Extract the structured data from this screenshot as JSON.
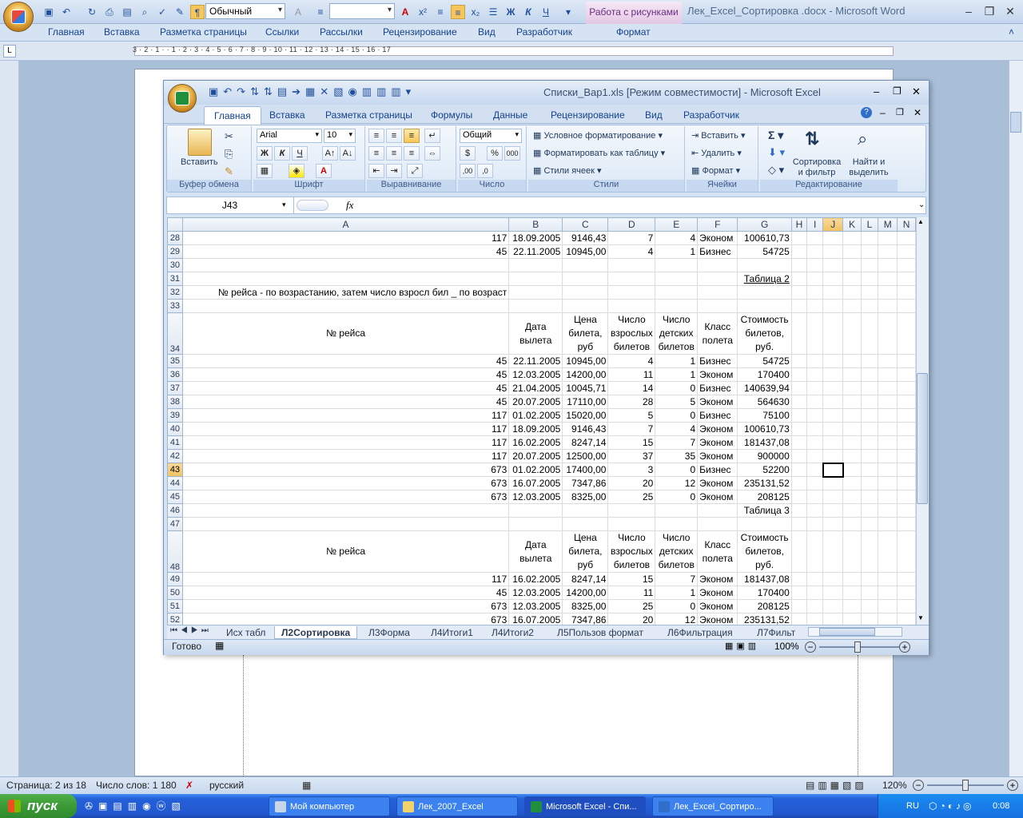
{
  "word": {
    "style_combo": "Обычный",
    "context_tab": "Работа с рисунками",
    "caption": "Лек_Excel_Сортировка .docx - Microsoft Word",
    "tabs": [
      "Главная",
      "Вставка",
      "Разметка страницы",
      "Ссылки",
      "Рассылки",
      "Рецензирование",
      "Вид",
      "Разработчик",
      "Формат"
    ],
    "ruler_numbers": "3 · 2 · 1 · · 1 · 2 · 3 · 4 · 5 · 6 · 7 · 8 · 9 · 10 · 11 · 12 · 13 · 14 · 15 · 16 · 17",
    "status": {
      "page": "Страница: 2 из 18",
      "words": "Число слов: 1 180",
      "lang": "русский",
      "zoom": "120%"
    }
  },
  "taskbar": {
    "start": "пуск",
    "items": [
      "Мой компьютер",
      "Лек_2007_Excel",
      "Microsoft Excel - Спи...",
      "Лек_Excel_Сортиро..."
    ],
    "lang": "RU",
    "clock": "0:08"
  },
  "excel": {
    "caption": "Списки_Вар1.xls  [Режим совместимости] - Microsoft Excel",
    "tabs": [
      "Главная",
      "Вставка",
      "Разметка страницы",
      "Формулы",
      "Данные",
      "Рецензирование",
      "Вид",
      "Разработчик"
    ],
    "ribbon": {
      "paste": "Вставить",
      "font_name": "Arial",
      "font_size": "10",
      "number_format": "Общий",
      "cond_format": "Условное форматирование",
      "format_table": "Форматировать как таблицу",
      "cell_styles": "Стили ячеек",
      "insert": "Вставить",
      "delete": "Удалить",
      "format": "Формат",
      "sort": "Сортировка и фильтр",
      "find": "Найти и выделить",
      "groups": [
        "Буфер обмена",
        "Шрифт",
        "Выравнивание",
        "Число",
        "Стили",
        "Ячейки",
        "Редактирование"
      ]
    },
    "name_box": "J43",
    "fx": "fx",
    "columns": [
      "A",
      "B",
      "C",
      "D",
      "E",
      "F",
      "G",
      "H",
      "I",
      "J",
      "K",
      "L",
      "M",
      "N"
    ],
    "rows": [
      {
        "n": "28",
        "cells": [
          "117",
          "18.09.2005",
          "9146,43",
          "7",
          "4",
          "Эконом",
          "100610,73"
        ]
      },
      {
        "n": "29",
        "cells": [
          "45",
          "22.11.2005",
          "10945,00",
          "4",
          "1",
          "Бизнес",
          "54725"
        ]
      },
      {
        "n": "30",
        "cells": [
          "",
          "",
          "",
          "",
          "",
          "",
          ""
        ]
      },
      {
        "n": "31",
        "cells": [
          "",
          "",
          "",
          "",
          "",
          "",
          "Таблица 2"
        ]
      },
      {
        "n": "32",
        "cells": [
          "№ рейса - по возрастанию, затем число взросл бил _ по возраст",
          "",
          "",
          "",
          "",
          "",
          ""
        ]
      },
      {
        "n": "33",
        "cells": [
          "",
          "",
          "",
          "",
          "",
          "",
          ""
        ]
      },
      {
        "n": "34",
        "hdr": true,
        "cells": [
          "№ рейса",
          "Дата вылета",
          "Цена билета, руб",
          "Число взрослых билетов",
          "Число детских билетов",
          "Класс полета",
          "Стоимость билетов, руб."
        ]
      },
      {
        "n": "35",
        "cells": [
          "45",
          "22.11.2005",
          "10945,00",
          "4",
          "1",
          "Бизнес",
          "54725"
        ]
      },
      {
        "n": "36",
        "cells": [
          "45",
          "12.03.2005",
          "14200,00",
          "11",
          "1",
          "Эконом",
          "170400"
        ]
      },
      {
        "n": "37",
        "cells": [
          "45",
          "21.04.2005",
          "10045,71",
          "14",
          "0",
          "Бизнес",
          "140639,94"
        ]
      },
      {
        "n": "38",
        "cells": [
          "45",
          "20.07.2005",
          "17110,00",
          "28",
          "5",
          "Эконом",
          "564630"
        ]
      },
      {
        "n": "39",
        "cells": [
          "117",
          "01.02.2005",
          "15020,00",
          "5",
          "0",
          "Бизнес",
          "75100"
        ]
      },
      {
        "n": "40",
        "cells": [
          "117",
          "18.09.2005",
          "9146,43",
          "7",
          "4",
          "Эконом",
          "100610,73"
        ]
      },
      {
        "n": "41",
        "cells": [
          "117",
          "16.02.2005",
          "8247,14",
          "15",
          "7",
          "Эконом",
          "181437,08"
        ]
      },
      {
        "n": "42",
        "cells": [
          "117",
          "20.07.2005",
          "12500,00",
          "37",
          "35",
          "Эконом",
          "900000"
        ]
      },
      {
        "n": "43",
        "cells": [
          "673",
          "01.02.2005",
          "17400,00",
          "3",
          "0",
          "Бизнес",
          "52200"
        ]
      },
      {
        "n": "44",
        "cells": [
          "673",
          "16.07.2005",
          "7347,86",
          "20",
          "12",
          "Эконом",
          "235131,52"
        ]
      },
      {
        "n": "45",
        "cells": [
          "673",
          "12.03.2005",
          "8325,00",
          "25",
          "0",
          "Эконом",
          "208125"
        ]
      },
      {
        "n": "46",
        "cells": [
          "",
          "",
          "",
          "",
          "",
          "",
          "Таблица 3"
        ]
      },
      {
        "n": "47",
        "cells": [
          "",
          "",
          "",
          "",
          "",
          "",
          ""
        ]
      },
      {
        "n": "48",
        "hdr": true,
        "cells": [
          "№ рейса",
          "Дата вылета",
          "Цена билета, руб",
          "Число взрослых билетов",
          "Число детских билетов",
          "Класс полета",
          "Стоимость билетов, руб."
        ]
      },
      {
        "n": "49",
        "cells": [
          "117",
          "16.02.2005",
          "8247,14",
          "15",
          "7",
          "Эконом",
          "181437,08"
        ]
      },
      {
        "n": "50",
        "cells": [
          "45",
          "12.03.2005",
          "14200,00",
          "11",
          "1",
          "Эконом",
          "170400"
        ]
      },
      {
        "n": "51",
        "cells": [
          "673",
          "12.03.2005",
          "8325,00",
          "25",
          "0",
          "Эконом",
          "208125"
        ]
      },
      {
        "n": "52",
        "cells": [
          "673",
          "16.07.2005",
          "7347,86",
          "20",
          "12",
          "Эконом",
          "235131,52"
        ]
      }
    ],
    "sheets": [
      "Исх табл",
      "Л2Сортировка",
      "Л3Форма",
      "Л4Итоги1",
      "Л4Итоги2",
      "Л5Пользов формат",
      "Л6Фильтрация",
      "Л7Фильт"
    ],
    "active_sheet": "Л2Сортировка",
    "status": {
      "ready": "Готово",
      "zoom": "100%"
    }
  }
}
